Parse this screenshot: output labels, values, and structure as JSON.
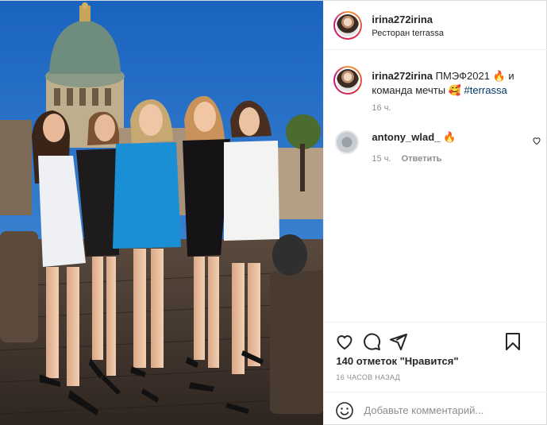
{
  "post": {
    "image_alt": "",
    "author": {
      "username": "irina272irina",
      "location": "Ресторан terrassa"
    },
    "caption": {
      "username": "irina272irina",
      "text_before": "ПМЭФ2021",
      "emoji1": "🔥",
      "text_middle": "и команда мечты",
      "emoji2": "🥰",
      "hashtag": "#terrassa",
      "time": "16 ч."
    },
    "comments": [
      {
        "username": "antony_wlad_",
        "text": "🔥",
        "time": "15 ч.",
        "reply_label": "Ответить"
      }
    ],
    "likes_text": "140 отметок \"Нравится\"",
    "time_ago": "16 ЧАСОВ НАЗАД",
    "comment_placeholder": "Добавьте комментарий..."
  },
  "icons": {
    "like": "heart-icon",
    "comment": "comment-icon",
    "share": "paper-plane-icon",
    "save": "bookmark-icon",
    "emoji": "smiley-icon"
  },
  "colors": {
    "text": "#262626",
    "secondary": "#8e8e8e",
    "hashtag": "#00376b",
    "border": "#dbdbdb"
  }
}
